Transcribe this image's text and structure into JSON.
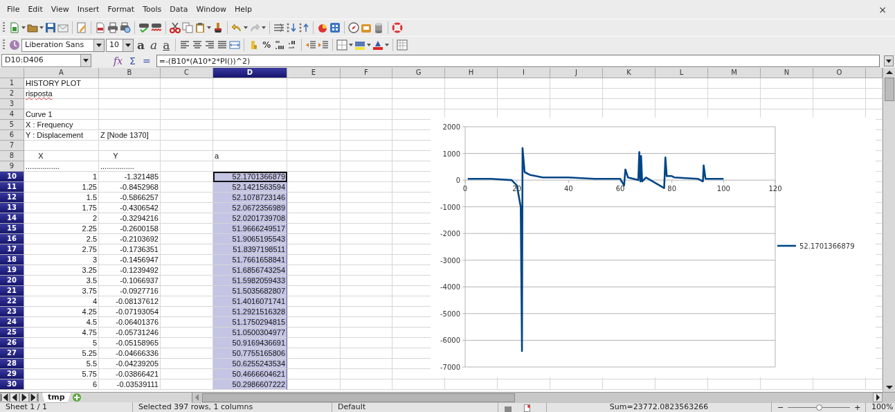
{
  "menu": [
    "File",
    "Edit",
    "View",
    "Insert",
    "Format",
    "Tools",
    "Data",
    "Window",
    "Help"
  ],
  "close": "×",
  "standard_toolbar": {
    "undo": {
      "disabled": false
    },
    "redo": {
      "disabled": true
    }
  },
  "formatting_toolbar": {
    "font_name": "Liberation Sans",
    "font_size": "10",
    "text_styles": [
      {
        "label": "a",
        "kind": "bold"
      },
      {
        "label": "a",
        "kind": "italic"
      },
      {
        "label": "a",
        "kind": "underline"
      }
    ],
    "percent": "%"
  },
  "formula_bar": {
    "name_box": "D10:D406",
    "function_wizard": "fx",
    "sum": "Σ",
    "equals": "=",
    "formula": "=-(B10*(A10*2*PI())^2)"
  },
  "columns": [
    {
      "label": "A",
      "selected": false
    },
    {
      "label": "B",
      "selected": false
    },
    {
      "label": "C",
      "selected": false
    },
    {
      "label": "D",
      "selected": true
    },
    {
      "label": "E",
      "selected": false
    },
    {
      "label": "F",
      "selected": false
    },
    {
      "label": "G",
      "selected": false
    },
    {
      "label": "H",
      "selected": false
    },
    {
      "label": "I",
      "selected": false
    },
    {
      "label": "J",
      "selected": false
    },
    {
      "label": "K",
      "selected": false
    },
    {
      "label": "L",
      "selected": false
    },
    {
      "label": "M",
      "selected": false
    },
    {
      "label": "N",
      "selected": false
    },
    {
      "label": "O",
      "selected": false
    }
  ],
  "rows": [
    {
      "number": "1",
      "selected": false,
      "cells": {
        "A": {
          "text": "HISTORY PLOT",
          "kind": "text"
        }
      }
    },
    {
      "number": "2",
      "selected": false,
      "cells": {
        "A": {
          "text": "risposta",
          "kind": "text",
          "misspelled": true
        }
      }
    },
    {
      "number": "3",
      "selected": false,
      "cells": {}
    },
    {
      "number": "4",
      "selected": false,
      "cells": {
        "A": {
          "text": "Curve 1",
          "kind": "text"
        }
      }
    },
    {
      "number": "5",
      "selected": false,
      "cells": {
        "A": {
          "text": "X : Frequency",
          "kind": "text"
        }
      }
    },
    {
      "number": "6",
      "selected": false,
      "cells": {
        "A": {
          "text": "Y : Displacement",
          "kind": "text"
        },
        "B": {
          "text": "Z [Node 1370]",
          "kind": "text"
        }
      }
    },
    {
      "number": "7",
      "selected": false,
      "cells": {}
    },
    {
      "number": "8",
      "selected": false,
      "cells": {
        "A": {
          "text": "      X",
          "kind": "text"
        },
        "B": {
          "text": "      Y",
          "kind": "text"
        },
        "D": {
          "text": "a",
          "kind": "text"
        }
      }
    },
    {
      "number": "9",
      "selected": false,
      "cells": {
        "A": {
          "text": "................",
          "kind": "text"
        },
        "B": {
          "text": "................",
          "kind": "text"
        }
      }
    },
    {
      "number": "10",
      "selected": true,
      "cells": {
        "A": {
          "text": "1",
          "kind": "number"
        },
        "B": {
          "text": "-1.321485",
          "kind": "number"
        },
        "D": {
          "text": "52.1701366879",
          "kind": "number",
          "selected": true,
          "active": true
        }
      }
    },
    {
      "number": "11",
      "selected": true,
      "cells": {
        "A": {
          "text": "1.25",
          "kind": "number"
        },
        "B": {
          "text": "-0.8452968",
          "kind": "number"
        },
        "D": {
          "text": "52.1421563594",
          "kind": "number",
          "selected": true
        }
      }
    },
    {
      "number": "12",
      "selected": true,
      "cells": {
        "A": {
          "text": "1.5",
          "kind": "number"
        },
        "B": {
          "text": "-0.5866257",
          "kind": "number"
        },
        "D": {
          "text": "52.1078723146",
          "kind": "number",
          "selected": true
        }
      }
    },
    {
      "number": "13",
      "selected": true,
      "cells": {
        "A": {
          "text": "1.75",
          "kind": "number"
        },
        "B": {
          "text": "-0.4306542",
          "kind": "number"
        },
        "D": {
          "text": "52.0672356989",
          "kind": "number",
          "selected": true
        }
      }
    },
    {
      "number": "14",
      "selected": true,
      "cells": {
        "A": {
          "text": "2",
          "kind": "number"
        },
        "B": {
          "text": "-0.3294216",
          "kind": "number"
        },
        "D": {
          "text": "52.0201739708",
          "kind": "number",
          "selected": true
        }
      }
    },
    {
      "number": "15",
      "selected": true,
      "cells": {
        "A": {
          "text": "2.25",
          "kind": "number"
        },
        "B": {
          "text": "-0.2600158",
          "kind": "number"
        },
        "D": {
          "text": "51.9666249517",
          "kind": "number",
          "selected": true
        }
      }
    },
    {
      "number": "16",
      "selected": true,
      "cells": {
        "A": {
          "text": "2.5",
          "kind": "number"
        },
        "B": {
          "text": "-0.2103692",
          "kind": "number"
        },
        "D": {
          "text": "51.9065195543",
          "kind": "number",
          "selected": true
        }
      }
    },
    {
      "number": "17",
      "selected": true,
      "cells": {
        "A": {
          "text": "2.75",
          "kind": "number"
        },
        "B": {
          "text": "-0.1736351",
          "kind": "number"
        },
        "D": {
          "text": "51.8397198511",
          "kind": "number",
          "selected": true
        }
      }
    },
    {
      "number": "18",
      "selected": true,
      "cells": {
        "A": {
          "text": "3",
          "kind": "number"
        },
        "B": {
          "text": "-0.1456947",
          "kind": "number"
        },
        "D": {
          "text": "51.7661658841",
          "kind": "number",
          "selected": true
        }
      }
    },
    {
      "number": "19",
      "selected": true,
      "cells": {
        "A": {
          "text": "3.25",
          "kind": "number"
        },
        "B": {
          "text": "-0.1239492",
          "kind": "number"
        },
        "D": {
          "text": "51.6856743254",
          "kind": "number",
          "selected": true
        }
      }
    },
    {
      "number": "20",
      "selected": true,
      "cells": {
        "A": {
          "text": "3.5",
          "kind": "number"
        },
        "B": {
          "text": "-0.1066937",
          "kind": "number"
        },
        "D": {
          "text": "51.5982059433",
          "kind": "number",
          "selected": true
        }
      }
    },
    {
      "number": "21",
      "selected": true,
      "cells": {
        "A": {
          "text": "3.75",
          "kind": "number"
        },
        "B": {
          "text": "-0.0927716",
          "kind": "number"
        },
        "D": {
          "text": "51.5035682807",
          "kind": "number",
          "selected": true
        }
      }
    },
    {
      "number": "22",
      "selected": true,
      "cells": {
        "A": {
          "text": "4",
          "kind": "number"
        },
        "B": {
          "text": "-0.08137612",
          "kind": "number"
        },
        "D": {
          "text": "51.4016071741",
          "kind": "number",
          "selected": true
        }
      }
    },
    {
      "number": "23",
      "selected": true,
      "cells": {
        "A": {
          "text": "4.25",
          "kind": "number"
        },
        "B": {
          "text": "-0.07193054",
          "kind": "number"
        },
        "D": {
          "text": "51.2921516328",
          "kind": "number",
          "selected": true
        }
      }
    },
    {
      "number": "24",
      "selected": true,
      "cells": {
        "A": {
          "text": "4.5",
          "kind": "number"
        },
        "B": {
          "text": "-0.06401376",
          "kind": "number"
        },
        "D": {
          "text": "51.1750294815",
          "kind": "number",
          "selected": true
        }
      }
    },
    {
      "number": "25",
      "selected": true,
      "cells": {
        "A": {
          "text": "4.75",
          "kind": "number"
        },
        "B": {
          "text": "-0.05731246",
          "kind": "number"
        },
        "D": {
          "text": "51.0500304977",
          "kind": "number",
          "selected": true
        }
      }
    },
    {
      "number": "26",
      "selected": true,
      "cells": {
        "A": {
          "text": "5",
          "kind": "number"
        },
        "B": {
          "text": "-0.05158965",
          "kind": "number"
        },
        "D": {
          "text": "50.9169436691",
          "kind": "number",
          "selected": true
        }
      }
    },
    {
      "number": "27",
      "selected": true,
      "cells": {
        "A": {
          "text": "5.25",
          "kind": "number"
        },
        "B": {
          "text": "-0.04666336",
          "kind": "number"
        },
        "D": {
          "text": "50.7755165806",
          "kind": "number",
          "selected": true
        }
      }
    },
    {
      "number": "28",
      "selected": true,
      "cells": {
        "A": {
          "text": "5.5",
          "kind": "number"
        },
        "B": {
          "text": "-0.04239205",
          "kind": "number"
        },
        "D": {
          "text": "50.6255243534",
          "kind": "number",
          "selected": true
        }
      }
    },
    {
      "number": "29",
      "selected": true,
      "cells": {
        "A": {
          "text": "5.75",
          "kind": "number"
        },
        "B": {
          "text": "-0.03866421",
          "kind": "number"
        },
        "D": {
          "text": "50.4666604621",
          "kind": "number",
          "selected": true
        }
      }
    },
    {
      "number": "30",
      "selected": true,
      "cells": {
        "A": {
          "text": "6",
          "kind": "number"
        },
        "B": {
          "text": "-0.03539111",
          "kind": "number"
        },
        "D": {
          "text": "50.2986607222",
          "kind": "number",
          "selected": true
        }
      }
    }
  ],
  "chart": {
    "chart_data": {
      "type": "line",
      "grid": true,
      "x": [
        1,
        10,
        18,
        20,
        21.5,
        22,
        22.2,
        23,
        25,
        30,
        40,
        50,
        60,
        61.5,
        62,
        63,
        67,
        67.4,
        67.8,
        68.1,
        68.5,
        70,
        77,
        77.5,
        78,
        80,
        81,
        90,
        92,
        92.3,
        93,
        100
      ],
      "series": [
        {
          "name": "52.1701366879",
          "color": "#004586",
          "values": [
            50,
            50,
            0,
            -200,
            -1000,
            -6400,
            1200,
            300,
            200,
            100,
            100,
            50,
            50,
            -200,
            400,
            100,
            0,
            1050,
            -50,
            900,
            -50,
            100,
            -300,
            850,
            150,
            150,
            100,
            50,
            -50,
            550,
            50,
            50
          ]
        }
      ],
      "xlim": [
        0,
        120
      ],
      "ylim": [
        -7000,
        2000
      ],
      "xticks": [
        0,
        20,
        40,
        60,
        80,
        100,
        120
      ],
      "yticks": [
        2000,
        1000,
        0,
        -1000,
        -2000,
        -3000,
        -4000,
        -5000,
        -6000,
        -7000
      ]
    }
  },
  "sheet_tabs": [
    {
      "label": "tmp",
      "selected": true
    }
  ],
  "status_bar": {
    "sheet": "Sheet 1 / 1",
    "selection": "Selected 397 rows, 1 columns",
    "page_style": "Default",
    "sum": "Sum=23772.0823563266",
    "zoom": {
      "minus": "−",
      "plus": "+",
      "level": 0.5,
      "reading": "100%"
    }
  }
}
